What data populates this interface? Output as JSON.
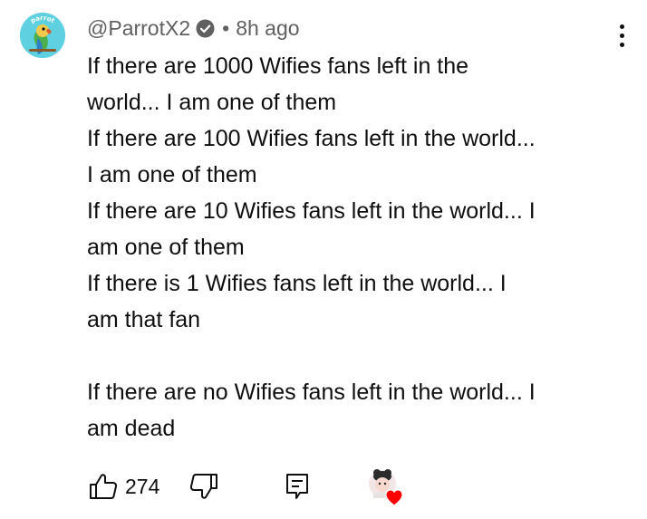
{
  "comment": {
    "author": "@ParrotX2",
    "time": "8h ago",
    "separator": "•",
    "avatar_text": "parrot",
    "lines": [
      "If there are 1000 Wifies fans left in the",
      "world... I am one of them",
      "If there are 100 Wifies fans left in the world...",
      "I am one of them",
      "If there are 10 Wifies fans left in the world... I",
      "am one of them",
      "If there is 1 Wifies fans left in the world... I",
      "am that fan",
      "",
      "If there are no Wifies fans left in the world... I",
      "am dead"
    ],
    "like_count": "274"
  },
  "icons": {
    "verified": "verified-check-icon",
    "menu": "more-vert-icon",
    "like": "thumbs-up-icon",
    "dislike": "thumbs-down-icon",
    "reply": "reply-icon",
    "heart": "creator-heart-icon"
  },
  "colors": {
    "text": "#0f0f0f",
    "meta": "#606060",
    "avatar_bg": "#5fd0df",
    "heart": "#ff0000"
  }
}
